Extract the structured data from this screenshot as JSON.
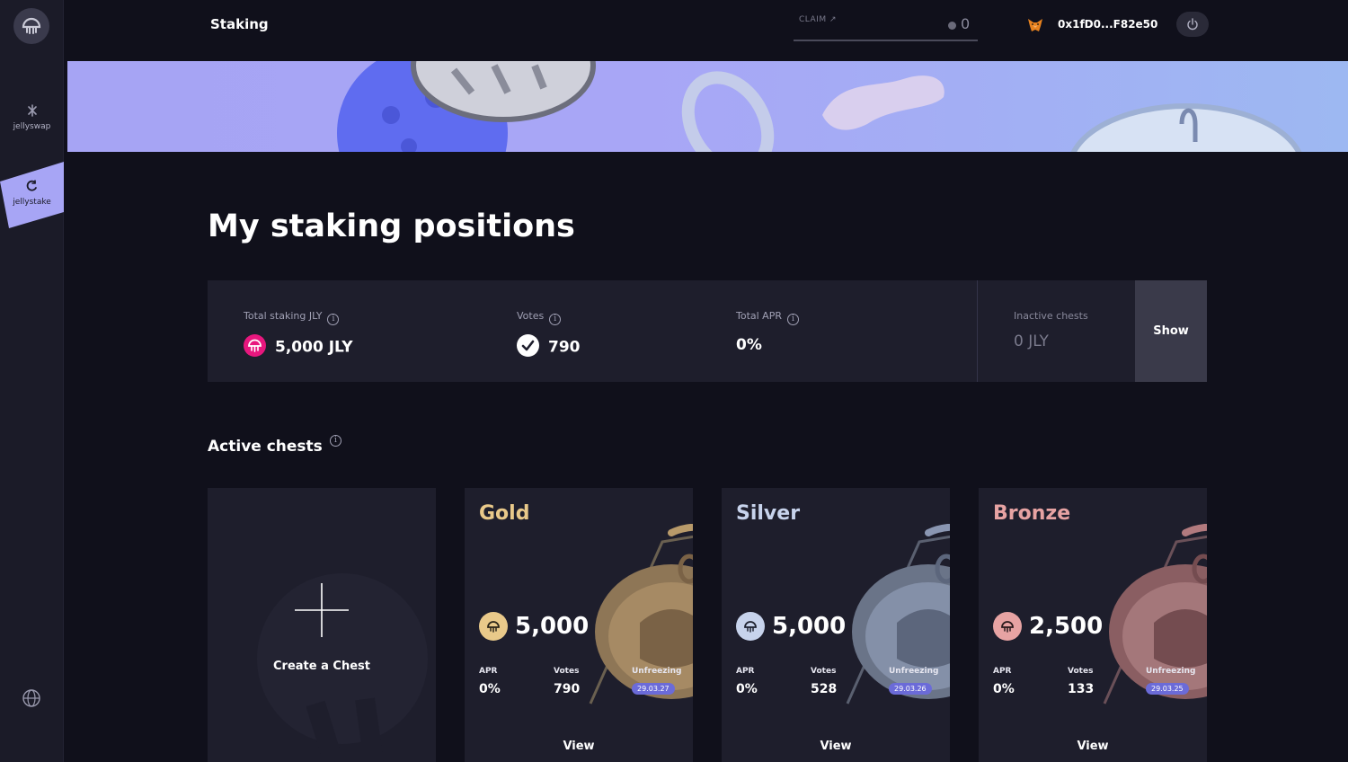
{
  "sidebar": {
    "items": [
      {
        "label": "jellyswap"
      },
      {
        "label": "jellystake"
      }
    ]
  },
  "header": {
    "title": "Staking",
    "claim_label": "CLAIM ↗",
    "claim_value": "0",
    "wallet": "0x1fD0...F82e50"
  },
  "main": {
    "heading": "My staking positions",
    "stats": {
      "total_staking_label": "Total staking JLY",
      "total_staking_value": "5,000 JLY",
      "votes_label": "Votes",
      "votes_value": "790",
      "apr_label": "Total APR",
      "apr_value": "0%",
      "inactive_label": "Inactive chests",
      "inactive_value": "0 JLY",
      "show_label": "Show"
    },
    "active_chests": {
      "title": "Active chests",
      "create_label": "Create a Chest",
      "apr_label": "APR",
      "votes_label": "Votes",
      "unfreezing_label": "Unfreezing",
      "view_label": "View",
      "chests": [
        {
          "name": "Gold",
          "amount": "5,000",
          "apr": "0%",
          "votes": "790",
          "unfreezing": "29.03.27",
          "color": "#e9c98a"
        },
        {
          "name": "Silver",
          "amount": "5,000",
          "apr": "0%",
          "votes": "528",
          "unfreezing": "29.03.26",
          "color": "#c7d3ec"
        },
        {
          "name": "Bronze",
          "amount": "2,500",
          "apr": "0%",
          "votes": "133",
          "unfreezing": "29.03.25",
          "color": "#e7a3a3"
        }
      ]
    }
  },
  "colors": {
    "accent": "#a6a4f4",
    "badge": "#6b6bd8",
    "jly_icon": "#e8177e"
  }
}
